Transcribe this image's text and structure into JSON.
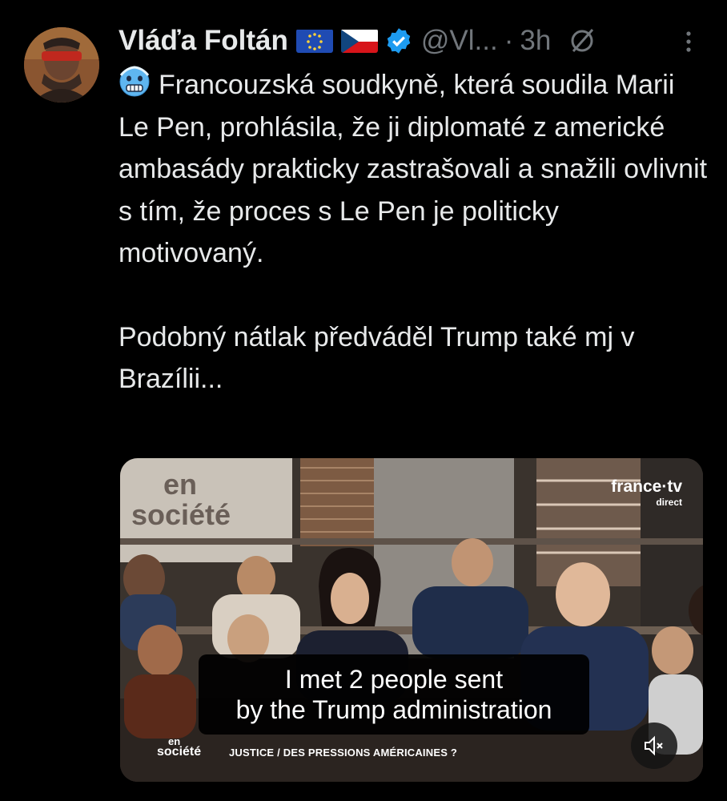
{
  "author": {
    "name": "Vláďa Foltán",
    "handle": "@Vl...",
    "time": "3h",
    "separator": "·"
  },
  "icons": {
    "avatar": "profile-photo",
    "flag_eu": "eu-flag-emoji",
    "flag_cz": "czech-flag-emoji",
    "verified": "verified-badge-icon",
    "grok": "grok-icon",
    "more": "more-options-icon",
    "emoji": "cold-face-emoji",
    "mute": "muted-speaker-icon"
  },
  "tweet": {
    "paragraph1": "Francouzská soudkyně, která soudila Marii Le Pen, prohlásila, že ji diplomaté z americké ambasády prakticky zastrašovali a snažili ovlivnit s tím, že proces s Le Pen je politicky motivovaný.",
    "paragraph2": "Podobný nátlak předváděl Trump také mj v Brazílii..."
  },
  "video": {
    "caption_line1": "I met 2 people sent",
    "caption_line2": "by the Trump administration",
    "brand": "france·tv",
    "brand_sub": "direct",
    "set_logo_line1": "en",
    "set_logo_line2": "société",
    "lower_third_small": "en",
    "lower_third_show": "société",
    "lower_third_text": "JUSTICE / DES PRESSIONS AMÉRICAINES ?"
  },
  "colors": {
    "background": "#000000",
    "text": "#e7e9ea",
    "secondary": "#71767b",
    "verified": "#1d9bf0"
  }
}
